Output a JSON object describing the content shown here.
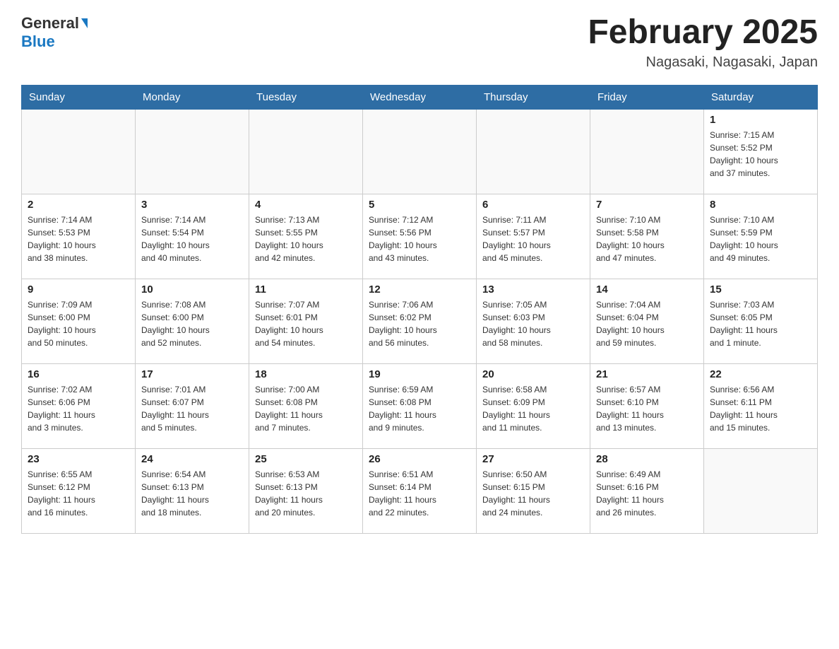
{
  "header": {
    "logo_general": "General",
    "logo_blue": "Blue",
    "title": "February 2025",
    "subtitle": "Nagasaki, Nagasaki, Japan"
  },
  "weekdays": [
    "Sunday",
    "Monday",
    "Tuesday",
    "Wednesday",
    "Thursday",
    "Friday",
    "Saturday"
  ],
  "weeks": [
    [
      {
        "day": "",
        "info": ""
      },
      {
        "day": "",
        "info": ""
      },
      {
        "day": "",
        "info": ""
      },
      {
        "day": "",
        "info": ""
      },
      {
        "day": "",
        "info": ""
      },
      {
        "day": "",
        "info": ""
      },
      {
        "day": "1",
        "info": "Sunrise: 7:15 AM\nSunset: 5:52 PM\nDaylight: 10 hours\nand 37 minutes."
      }
    ],
    [
      {
        "day": "2",
        "info": "Sunrise: 7:14 AM\nSunset: 5:53 PM\nDaylight: 10 hours\nand 38 minutes."
      },
      {
        "day": "3",
        "info": "Sunrise: 7:14 AM\nSunset: 5:54 PM\nDaylight: 10 hours\nand 40 minutes."
      },
      {
        "day": "4",
        "info": "Sunrise: 7:13 AM\nSunset: 5:55 PM\nDaylight: 10 hours\nand 42 minutes."
      },
      {
        "day": "5",
        "info": "Sunrise: 7:12 AM\nSunset: 5:56 PM\nDaylight: 10 hours\nand 43 minutes."
      },
      {
        "day": "6",
        "info": "Sunrise: 7:11 AM\nSunset: 5:57 PM\nDaylight: 10 hours\nand 45 minutes."
      },
      {
        "day": "7",
        "info": "Sunrise: 7:10 AM\nSunset: 5:58 PM\nDaylight: 10 hours\nand 47 minutes."
      },
      {
        "day": "8",
        "info": "Sunrise: 7:10 AM\nSunset: 5:59 PM\nDaylight: 10 hours\nand 49 minutes."
      }
    ],
    [
      {
        "day": "9",
        "info": "Sunrise: 7:09 AM\nSunset: 6:00 PM\nDaylight: 10 hours\nand 50 minutes."
      },
      {
        "day": "10",
        "info": "Sunrise: 7:08 AM\nSunset: 6:00 PM\nDaylight: 10 hours\nand 52 minutes."
      },
      {
        "day": "11",
        "info": "Sunrise: 7:07 AM\nSunset: 6:01 PM\nDaylight: 10 hours\nand 54 minutes."
      },
      {
        "day": "12",
        "info": "Sunrise: 7:06 AM\nSunset: 6:02 PM\nDaylight: 10 hours\nand 56 minutes."
      },
      {
        "day": "13",
        "info": "Sunrise: 7:05 AM\nSunset: 6:03 PM\nDaylight: 10 hours\nand 58 minutes."
      },
      {
        "day": "14",
        "info": "Sunrise: 7:04 AM\nSunset: 6:04 PM\nDaylight: 10 hours\nand 59 minutes."
      },
      {
        "day": "15",
        "info": "Sunrise: 7:03 AM\nSunset: 6:05 PM\nDaylight: 11 hours\nand 1 minute."
      }
    ],
    [
      {
        "day": "16",
        "info": "Sunrise: 7:02 AM\nSunset: 6:06 PM\nDaylight: 11 hours\nand 3 minutes."
      },
      {
        "day": "17",
        "info": "Sunrise: 7:01 AM\nSunset: 6:07 PM\nDaylight: 11 hours\nand 5 minutes."
      },
      {
        "day": "18",
        "info": "Sunrise: 7:00 AM\nSunset: 6:08 PM\nDaylight: 11 hours\nand 7 minutes."
      },
      {
        "day": "19",
        "info": "Sunrise: 6:59 AM\nSunset: 6:08 PM\nDaylight: 11 hours\nand 9 minutes."
      },
      {
        "day": "20",
        "info": "Sunrise: 6:58 AM\nSunset: 6:09 PM\nDaylight: 11 hours\nand 11 minutes."
      },
      {
        "day": "21",
        "info": "Sunrise: 6:57 AM\nSunset: 6:10 PM\nDaylight: 11 hours\nand 13 minutes."
      },
      {
        "day": "22",
        "info": "Sunrise: 6:56 AM\nSunset: 6:11 PM\nDaylight: 11 hours\nand 15 minutes."
      }
    ],
    [
      {
        "day": "23",
        "info": "Sunrise: 6:55 AM\nSunset: 6:12 PM\nDaylight: 11 hours\nand 16 minutes."
      },
      {
        "day": "24",
        "info": "Sunrise: 6:54 AM\nSunset: 6:13 PM\nDaylight: 11 hours\nand 18 minutes."
      },
      {
        "day": "25",
        "info": "Sunrise: 6:53 AM\nSunset: 6:13 PM\nDaylight: 11 hours\nand 20 minutes."
      },
      {
        "day": "26",
        "info": "Sunrise: 6:51 AM\nSunset: 6:14 PM\nDaylight: 11 hours\nand 22 minutes."
      },
      {
        "day": "27",
        "info": "Sunrise: 6:50 AM\nSunset: 6:15 PM\nDaylight: 11 hours\nand 24 minutes."
      },
      {
        "day": "28",
        "info": "Sunrise: 6:49 AM\nSunset: 6:16 PM\nDaylight: 11 hours\nand 26 minutes."
      },
      {
        "day": "",
        "info": ""
      }
    ]
  ]
}
